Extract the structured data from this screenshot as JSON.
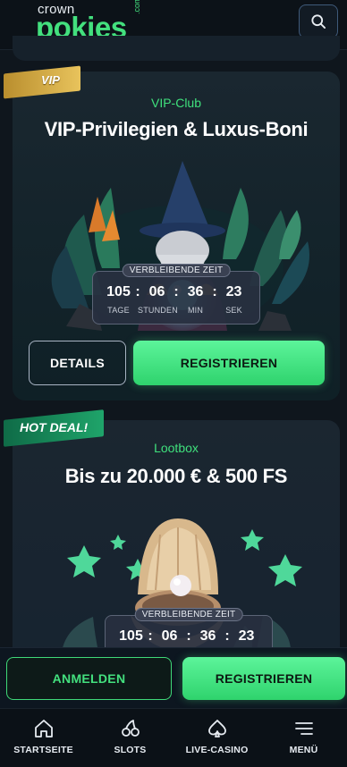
{
  "header": {
    "logo_top": "crown",
    "logo_main": "pokies",
    "logo_suffix": ".com",
    "search_icon": "search-icon"
  },
  "cards": [
    {
      "ribbon": "VIP",
      "subtitle": "VIP-Club",
      "title": "VIP-Privilegien & Luxus-Boni",
      "countdown": {
        "label": "VERBLEIBENDE ZEIT",
        "days": "105",
        "hours": "06",
        "minutes": "36",
        "seconds": "23",
        "units": [
          "TAGE",
          "STUNDEN",
          "MIN",
          "SEK"
        ]
      },
      "details_label": "DETAILS",
      "register_label": "REGISTRIEREN"
    },
    {
      "ribbon": "HOT DEAL!",
      "subtitle": "Lootbox",
      "title": "Bis zu 20.000 € & 500 FS",
      "countdown": {
        "label": "VERBLEIBENDE ZEIT",
        "days": "105",
        "hours": "06",
        "minutes": "36",
        "seconds": "23"
      }
    }
  ],
  "authbar": {
    "login_label": "ANMELDEN",
    "register_label": "REGISTRIEREN"
  },
  "bottom_nav": [
    {
      "label": "STARTSEITE",
      "icon": "home-icon"
    },
    {
      "label": "SLOTS",
      "icon": "cherries-icon"
    },
    {
      "label": "LIVE-CASINO",
      "icon": "spade-icon"
    },
    {
      "label": "MENÜ",
      "icon": "menu-icon"
    }
  ],
  "colors": {
    "accent_green": "#43e07e",
    "background": "#0f161d",
    "vip_gold": "#d4aa45",
    "hot_green": "#1a8a5a"
  }
}
